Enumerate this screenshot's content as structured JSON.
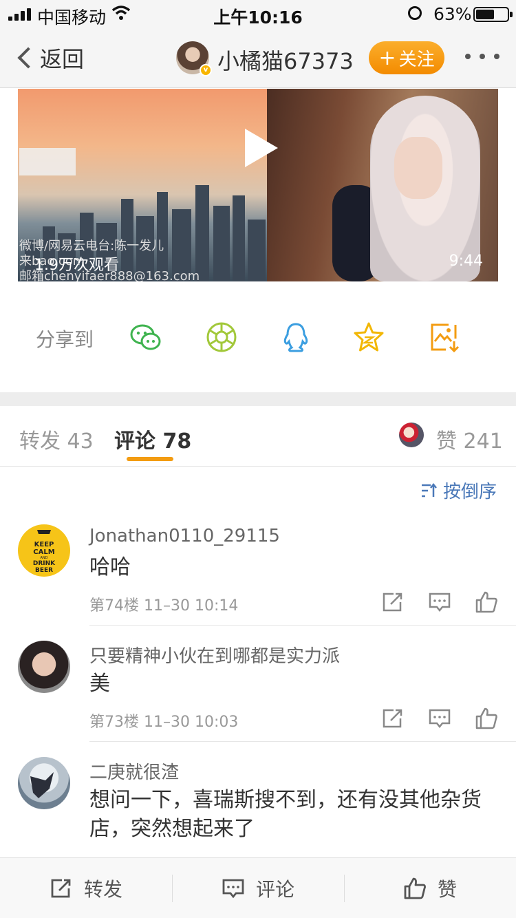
{
  "status_bar": {
    "carrier": "中国移动",
    "time": "上午10:16",
    "battery_percent": "63%",
    "battery_level": 0.63
  },
  "nav": {
    "back_label": "返回",
    "user_name": "小橘猫67373",
    "follow_label": "关注",
    "follow_plus": "+"
  },
  "video": {
    "views": "1.9万次观看",
    "duration": "9:44",
    "watermark_lines": [
      "微博/网易云电台:陈一发儿",
      "来bao.com",
      "邮箱chenyifaer888@163.com"
    ]
  },
  "share": {
    "label": "分享到",
    "targets": [
      "wechat-icon",
      "moments-icon",
      "qq-icon",
      "qzone-icon",
      "save-image-icon"
    ]
  },
  "tabs": {
    "repost_label": "转发",
    "repost_count": "43",
    "comment_label": "评论",
    "comment_count": "78",
    "like_label": "赞",
    "like_count": "241"
  },
  "sort_label": "按倒序",
  "comments": [
    {
      "user": "Jonathan0110_29115",
      "text": "哈哈",
      "meta": "第74楼 11–30 10:14"
    },
    {
      "user": "只要精神小伙在到哪都是实力派",
      "text": "美",
      "meta": "第73楼 11–30 10:03"
    },
    {
      "user": "二庚就很渣",
      "text": "想问一下，喜瑞斯搜不到，还有没其他杂货店，突然想起来了",
      "meta": ""
    }
  ],
  "avatar_text": [
    "KEEP",
    "CALM",
    "AND",
    "DRINK",
    "BEER"
  ],
  "bottom_bar": {
    "repost_label": "转发",
    "comment_label": "评论",
    "like_label": "赞"
  },
  "colors": {
    "accent_orange": "#f38b00",
    "tab_underline": "#f39c12",
    "link_blue": "#4a78b8",
    "wechat_green": "#3fb34f",
    "moments_green": "#a2c83a",
    "qq_blue": "#3b9ee0",
    "qzone_yellow": "#f2b705",
    "save_orange": "#f39c12"
  }
}
